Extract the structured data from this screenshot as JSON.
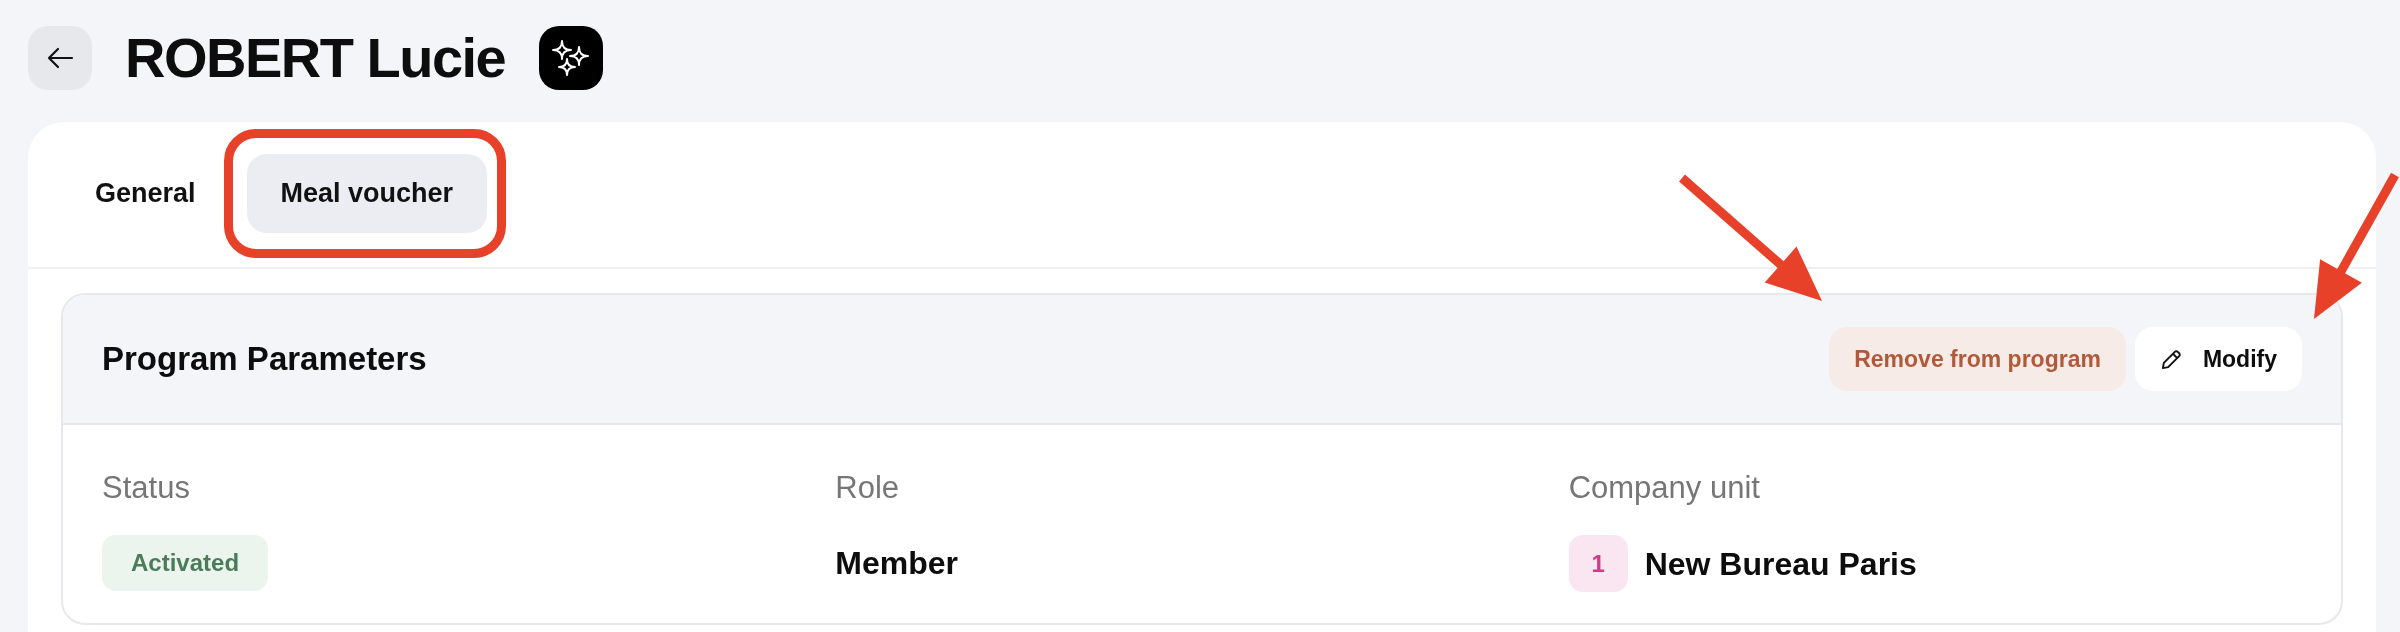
{
  "title": "ROBERT Lucie",
  "tabs": [
    {
      "label": "General",
      "selected": false,
      "highlighted": false
    },
    {
      "label": "Meal voucher",
      "selected": true,
      "highlighted": true
    }
  ],
  "section": {
    "title": "Program Parameters",
    "actions": [
      {
        "label": "Remove from program",
        "kind": "remove",
        "highlighted": true
      },
      {
        "label": "Modify",
        "kind": "edit",
        "highlighted": true
      }
    ],
    "fields": [
      {
        "label": "Status",
        "kind": "status",
        "value": "Activated"
      },
      {
        "label": "Role",
        "kind": "text",
        "value": "Member"
      },
      {
        "label": "Company unit",
        "kind": "unit",
        "code": "1",
        "value": "New Bureau Paris"
      }
    ]
  }
}
